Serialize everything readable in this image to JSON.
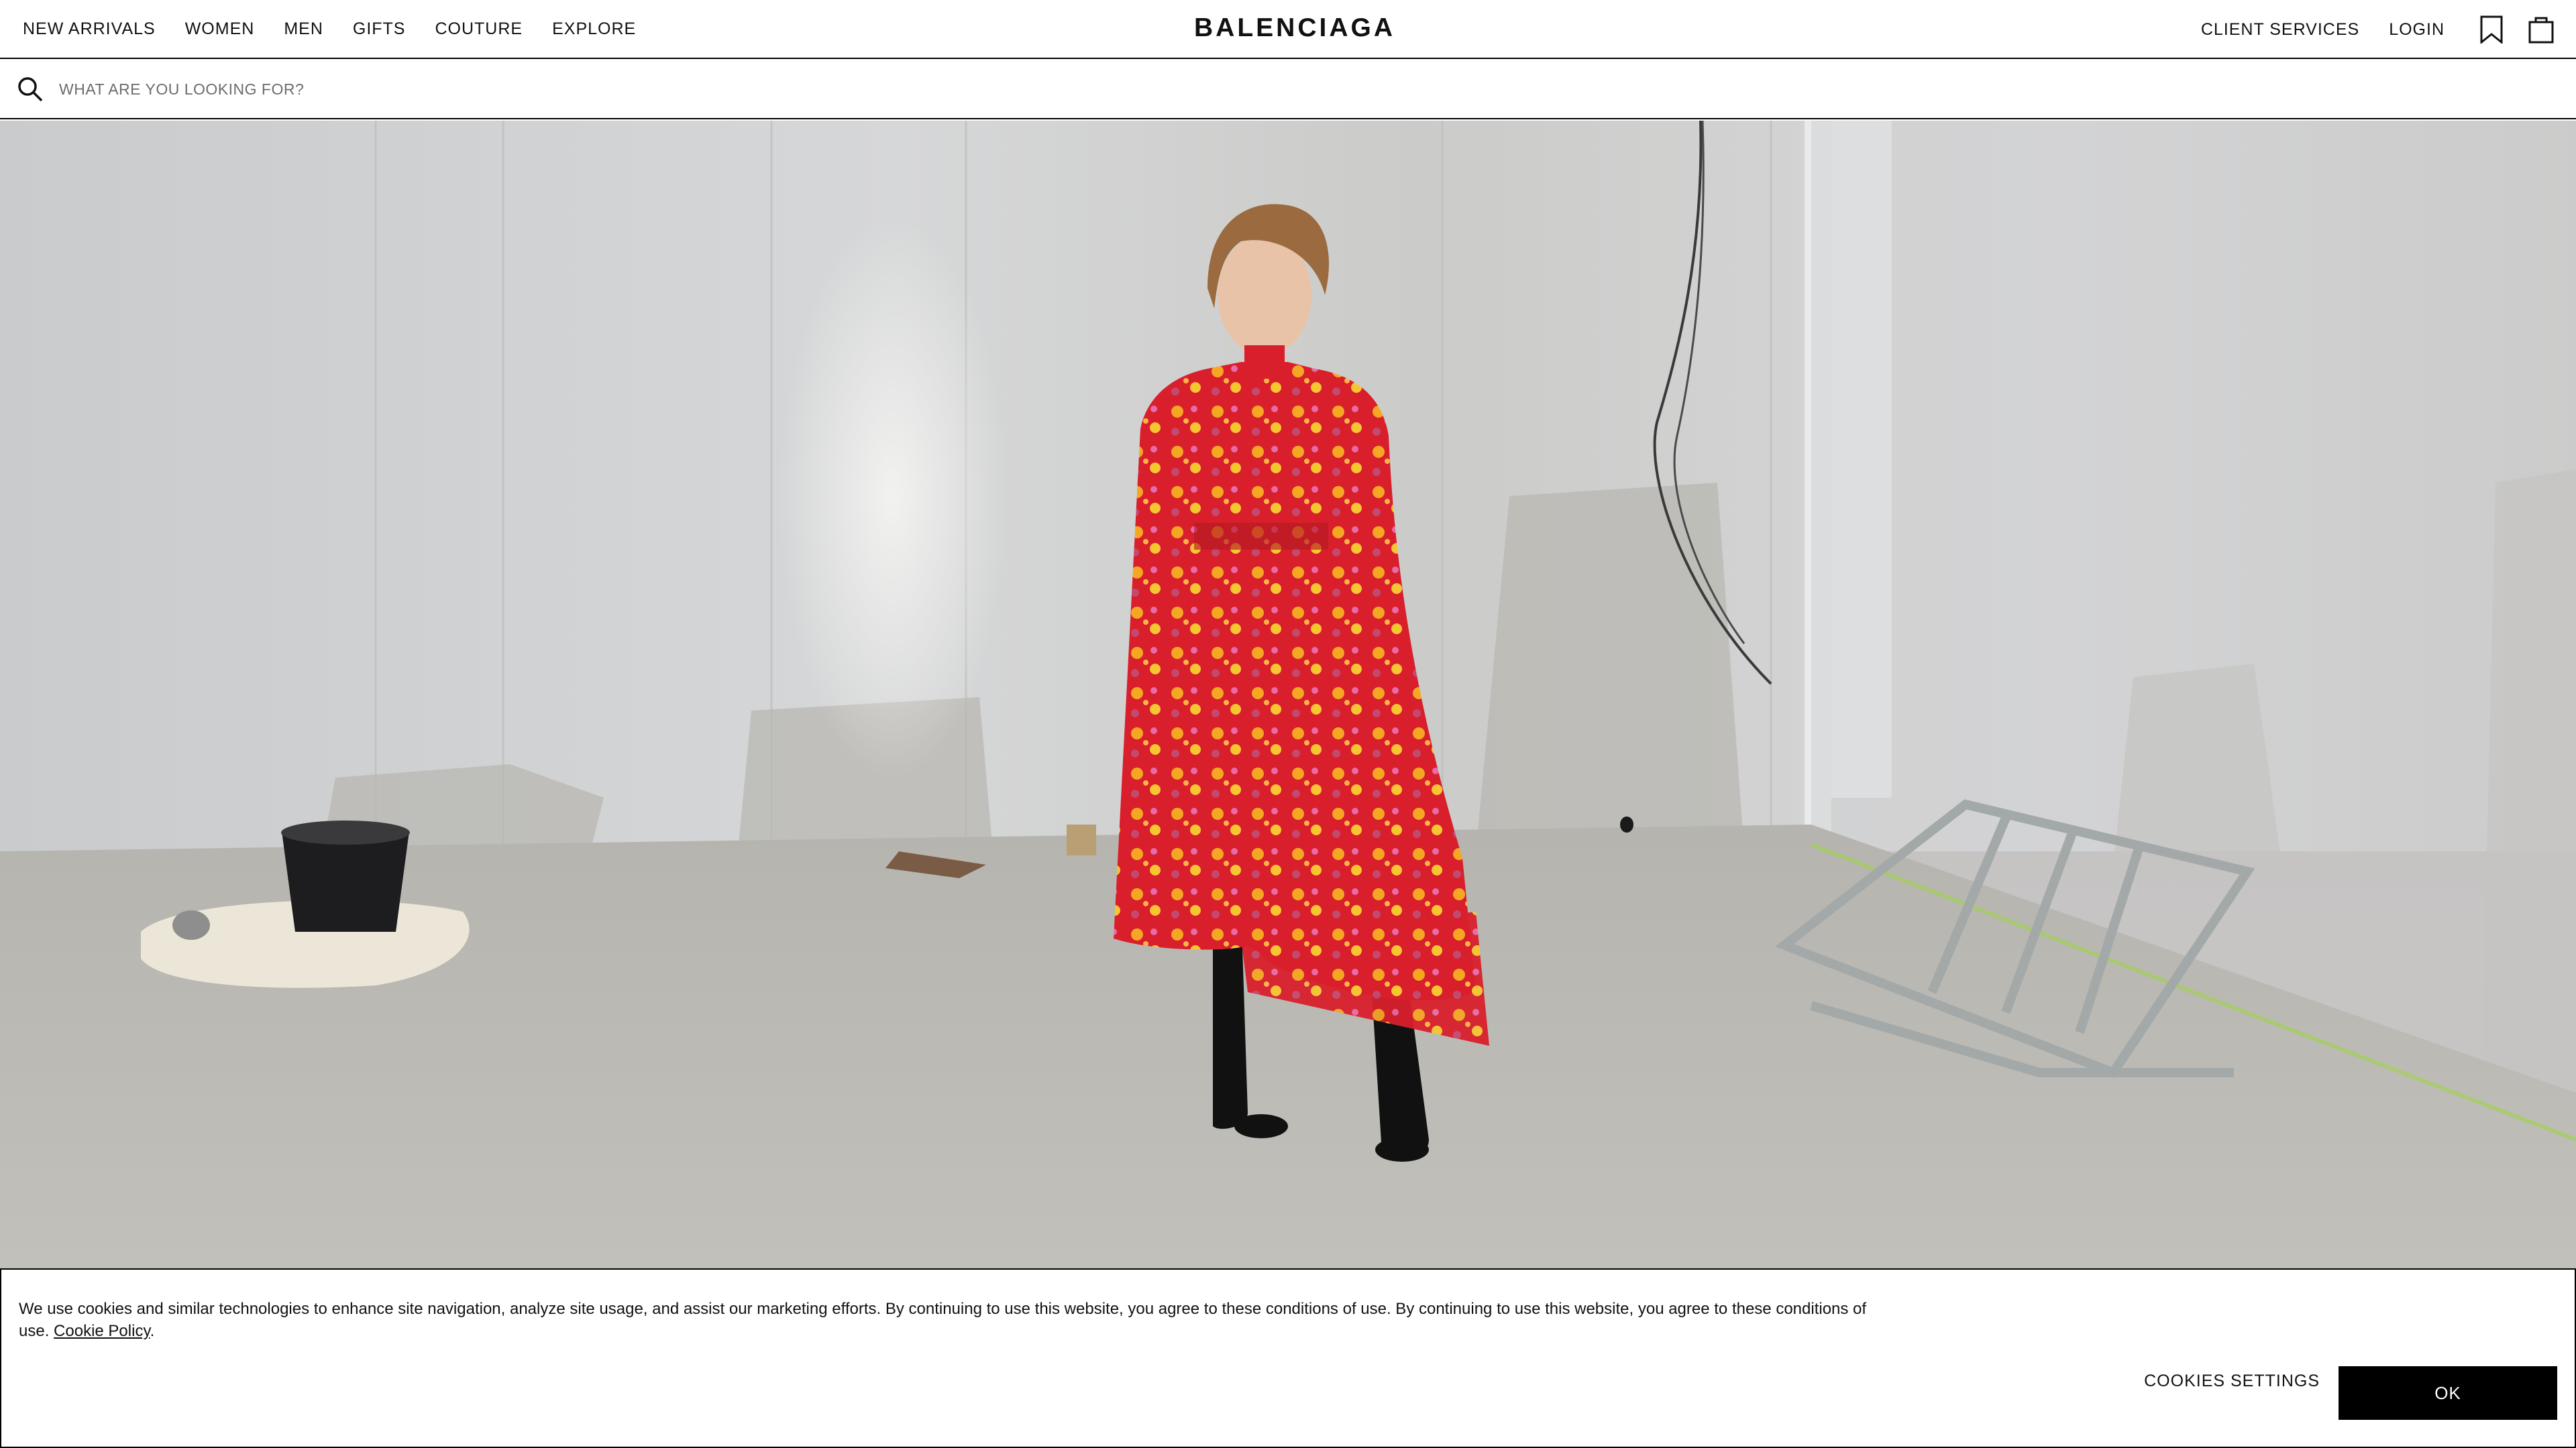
{
  "header": {
    "brand": "BALENCIAGA",
    "nav_left": [
      "NEW ARRIVALS",
      "WOMEN",
      "MEN",
      "GIFTS",
      "COUTURE",
      "EXPLORE"
    ],
    "nav_right": [
      "CLIENT SERVICES",
      "LOGIN"
    ],
    "icons": [
      "bookmark-icon",
      "shopping-bag-icon"
    ]
  },
  "search": {
    "placeholder": "WHAT ARE YOU LOOKING FOR?",
    "value": "",
    "icon": "search-icon"
  },
  "hero": {
    "image": "model-in-red-floral-dress-in-unfinished-room"
  },
  "cookie_banner": {
    "text": "We use cookies and similar technologies to enhance site navigation, analyze site usage, and assist our marketing efforts. By continuing to use this website, you agree to these conditions of use. By continuing to use this website, you agree to these conditions of use.",
    "link_label": "Cookie Policy",
    "settings_label": "COOKIES SETTINGS",
    "ok_label": "OK"
  },
  "colors": {
    "text": "#111111",
    "background": "#ffffff",
    "button": "#000000",
    "dress_red": "#d91f2a"
  }
}
